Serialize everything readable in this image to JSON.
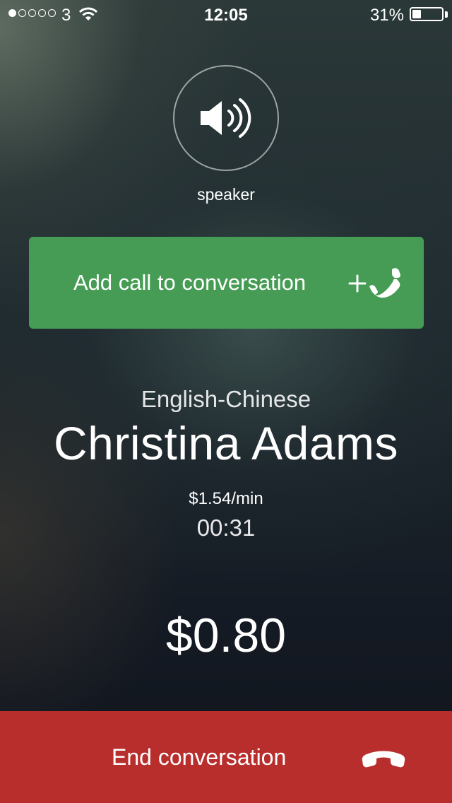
{
  "status_bar": {
    "carrier": "3",
    "time": "12:05",
    "battery_percent": "31%",
    "battery_level": 0.31,
    "signal_bars_filled": 1,
    "signal_bars_total": 5
  },
  "speaker": {
    "label": "speaker",
    "icon": "speaker-icon"
  },
  "add_call": {
    "label": "Add call to conversation",
    "icon": "add-phone-icon",
    "color": "#469c54"
  },
  "call": {
    "language": "English-Chinese",
    "interpreter_name": "Christina Adams",
    "rate": "$1.54/min",
    "duration": "00:31",
    "cost": "$0.80"
  },
  "end_call": {
    "label": "End conversation",
    "icon": "hang-up-icon",
    "color": "#b82e2c"
  }
}
